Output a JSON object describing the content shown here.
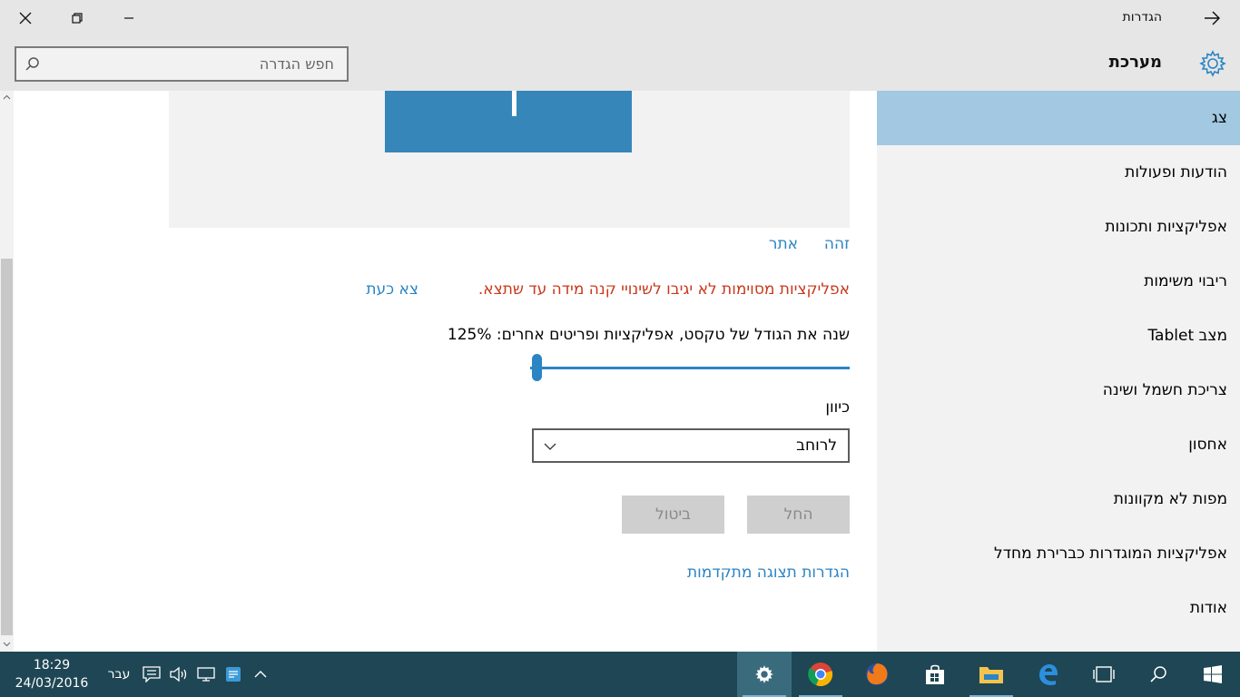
{
  "window": {
    "title": "הגדרות"
  },
  "header": {
    "section_title": "מערכת",
    "search_placeholder": "חפש הגדרה"
  },
  "sidebar": {
    "items": [
      {
        "label": "צג",
        "active": true
      },
      {
        "label": "הודעות ופעולות",
        "active": false
      },
      {
        "label": "אפליקציות ותכונות",
        "active": false
      },
      {
        "label": "ריבוי משימות",
        "active": false
      },
      {
        "label": "מצב Tablet",
        "active": false
      },
      {
        "label": "צריכת חשמל ושינה",
        "active": false
      },
      {
        "label": "אחסון",
        "active": false
      },
      {
        "label": "מפות לא מקוונות",
        "active": false
      },
      {
        "label": "אפליקציות המוגדרות כברירת מחדל",
        "active": false
      },
      {
        "label": "אודות",
        "active": false
      }
    ]
  },
  "display": {
    "identify_link": "זהה",
    "detect_link": "אתר",
    "warning_text": "אפליקציות מסוימות לא יגיבו לשינויי קנה מידה עד שתצא.",
    "signout_link": "צא כעת",
    "scale_label": "שנה את הגודל של טקסט, אפליקציות ופריטים אחרים: 125%",
    "scale_value_percent": 125,
    "orientation_label": "כיוון",
    "orientation_value": "לרוחב",
    "apply_button": "החל",
    "cancel_button": "ביטול",
    "advanced_link": "הגדרות תצוגה מתקדמות"
  },
  "taskbar": {
    "time": "18:29",
    "date": "24/03/2016",
    "language": "עבר",
    "apps": [
      "settings",
      "chrome",
      "firefox",
      "store",
      "file-explorer",
      "edge"
    ]
  },
  "colors": {
    "accent": "#2b84c4",
    "sidebar_active": "#a2c8e2",
    "warning": "#c9381b",
    "monitor": "#3686ba",
    "taskbar": "#1f4654"
  }
}
